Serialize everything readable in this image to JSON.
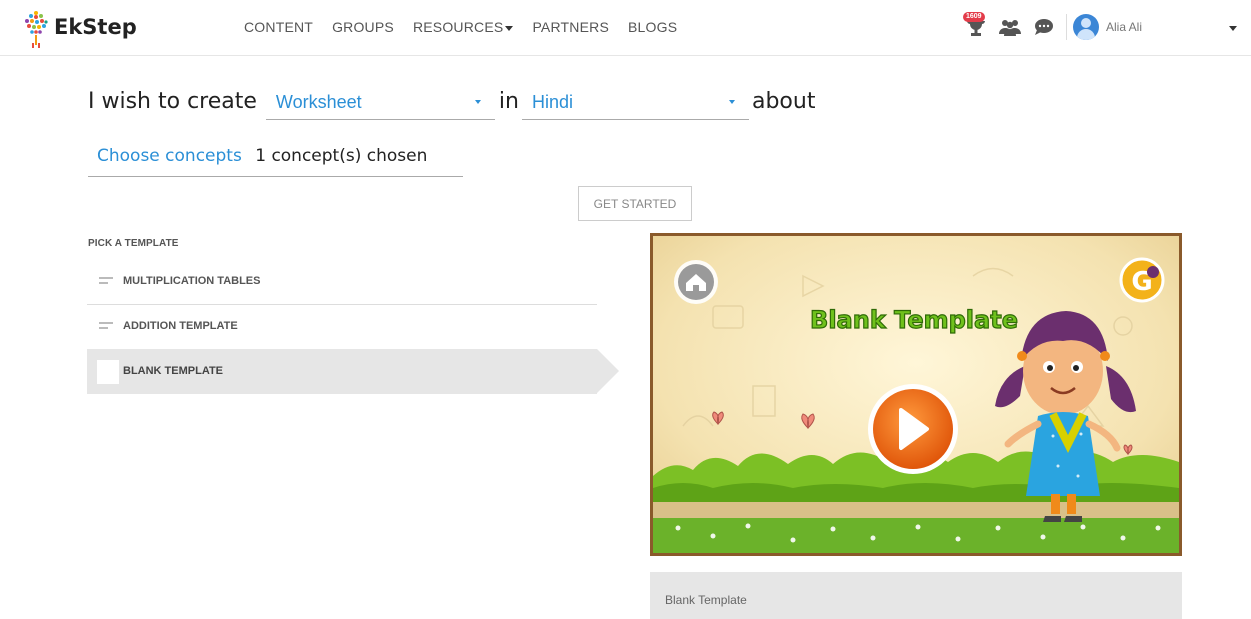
{
  "header": {
    "brand": "EkStep",
    "nav": [
      {
        "label": "CONTENT"
      },
      {
        "label": "GROUPS"
      },
      {
        "label": "RESOURCES"
      },
      {
        "label": "PARTNERS"
      },
      {
        "label": "BLOGS"
      }
    ],
    "notifications_badge": "1609",
    "user_name": "Alia Ali"
  },
  "create": {
    "prefix": "I wish to create",
    "type_value": "Worksheet",
    "connector": "in",
    "language_value": "Hindi",
    "suffix": "about"
  },
  "concepts": {
    "link_label": "Choose concepts",
    "chosen_text": "1 concept(s) chosen"
  },
  "get_started_label": "GET STARTED",
  "templates": {
    "heading": "PICK A TEMPLATE",
    "items": [
      {
        "label": "MULTIPLICATION TABLES"
      },
      {
        "label": "ADDITION TEMPLATE"
      },
      {
        "label": "BLANK TEMPLATE"
      }
    ],
    "selected_index": 2
  },
  "preview": {
    "title": "Blank Template",
    "caption": "Blank Template"
  },
  "colors": {
    "accent": "#2b8fd6",
    "badge": "#e33c4a",
    "selected_row": "#e6e6e6",
    "preview_border": "#8a5a2b",
    "play_button": "#f06a10"
  },
  "icons": [
    "logo-icon",
    "trophy-icon",
    "group-icon",
    "chat-icon",
    "user-avatar-icon",
    "home-icon",
    "play-icon"
  ]
}
